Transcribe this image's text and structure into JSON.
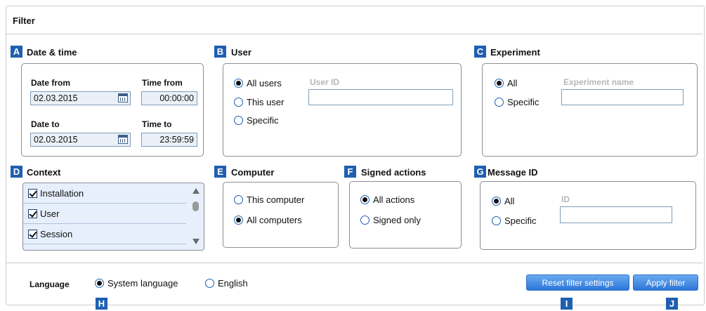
{
  "title": "Filter",
  "date_time": {
    "badge": "A",
    "title": "Date & time",
    "date_from_label": "Date from",
    "date_from_value": "02.03.2015",
    "time_from_label": "Time from",
    "time_from_value": "00:00:00",
    "date_to_label": "Date to",
    "date_to_value": "02.03.2015",
    "time_to_label": "Time to",
    "time_to_value": "23:59:59"
  },
  "user": {
    "badge": "B",
    "title": "User",
    "options": [
      "All users",
      "This user",
      "Specific"
    ],
    "selected": "All users",
    "user_id_label": "User ID",
    "user_id_value": ""
  },
  "experiment": {
    "badge": "C",
    "title": "Experiment",
    "options": [
      "All",
      "Specific"
    ],
    "selected": "All",
    "name_label": "Experiment name",
    "name_value": ""
  },
  "context": {
    "badge": "D",
    "title": "Context",
    "items": [
      {
        "label": "Installation",
        "checked": true
      },
      {
        "label": "User",
        "checked": true
      },
      {
        "label": "Session",
        "checked": true
      }
    ]
  },
  "computer": {
    "badge": "E",
    "title": "Computer",
    "options": [
      "This computer",
      "All computers"
    ],
    "selected": "All computers"
  },
  "signed_actions": {
    "badge": "F",
    "title": "Signed actions",
    "options": [
      "All actions",
      "Signed only"
    ],
    "selected": "All actions"
  },
  "message_id": {
    "badge": "G",
    "title": "Message ID",
    "options": [
      "All",
      "Specific"
    ],
    "selected": "All",
    "id_label": "ID",
    "id_value": ""
  },
  "language": {
    "label": "Language",
    "options": [
      "System language",
      "English"
    ],
    "selected": "System language",
    "badge": "H"
  },
  "buttons": {
    "reset_label": "Reset filter settings",
    "reset_badge": "I",
    "apply_label": "Apply filter",
    "apply_badge": "J"
  },
  "colors": {
    "badge_blue": "#1f5fb0",
    "button_blue": "#2b76d9",
    "list_background": "#e6effb"
  }
}
